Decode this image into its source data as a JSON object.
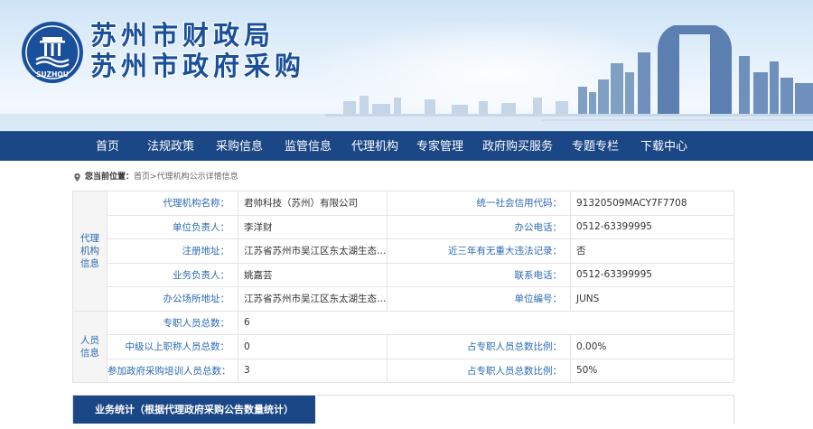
{
  "header": {
    "title_line1": "苏州市财政局",
    "title_line2": "苏州市政府采购",
    "logo_text": "SUZHOU",
    "colors": {
      "brand": "#1a4f9c",
      "nav": "#1c4786",
      "label": "#2a6ab5"
    }
  },
  "nav": {
    "items": [
      "首页",
      "法规政策",
      "采购信息",
      "监管信息",
      "代理机构",
      "专家管理",
      "政府购买服务",
      "专题专栏",
      "下载中心"
    ]
  },
  "breadcrumb": {
    "label": "您当前位置：",
    "home": "首页",
    "sep": " > ",
    "current": "代理机构公示详情信息"
  },
  "agency": {
    "group_label": "代理机构信息",
    "rows": [
      {
        "k1": "代理机构名称：",
        "v1": "君帅科技（苏州）有限公司",
        "k2": "统一社会信用代码：",
        "v2": "91320509MACY7F7708"
      },
      {
        "k1": "单位负责人：",
        "v1": "李洋财",
        "k2": "办公电话：",
        "v2": "0512-63399995"
      },
      {
        "k1": "注册地址：",
        "v1": "江苏省苏州市吴江区东太湖生态旅...",
        "k2": "近三年有无重大违法记录：",
        "v2": "否"
      },
      {
        "k1": "业务负责人：",
        "v1": "姚嘉芸",
        "k2": "联系电话：",
        "v2": "0512-63399995"
      },
      {
        "k1": "办公场所地址：",
        "v1": "江苏省苏州市吴江区东太湖生态旅...",
        "k2": "单位编号：",
        "v2": "JUNS"
      }
    ]
  },
  "staff": {
    "group_label": "人员信息",
    "row1": {
      "k1": "专职人员总数：",
      "v1": "6"
    },
    "rows": [
      {
        "k1": "中级以上职称人员总数：",
        "v1": "0",
        "k2": "占专职人员总数比例：",
        "v2": "0.00%"
      },
      {
        "k1": "参加政府采购培训人员总数：",
        "v1": "3",
        "k2": "占专职人员总数比例：",
        "v2": "50%"
      }
    ]
  },
  "stats": {
    "tab_label": "业务统计（根据代理政府采购公告数量统计）"
  }
}
